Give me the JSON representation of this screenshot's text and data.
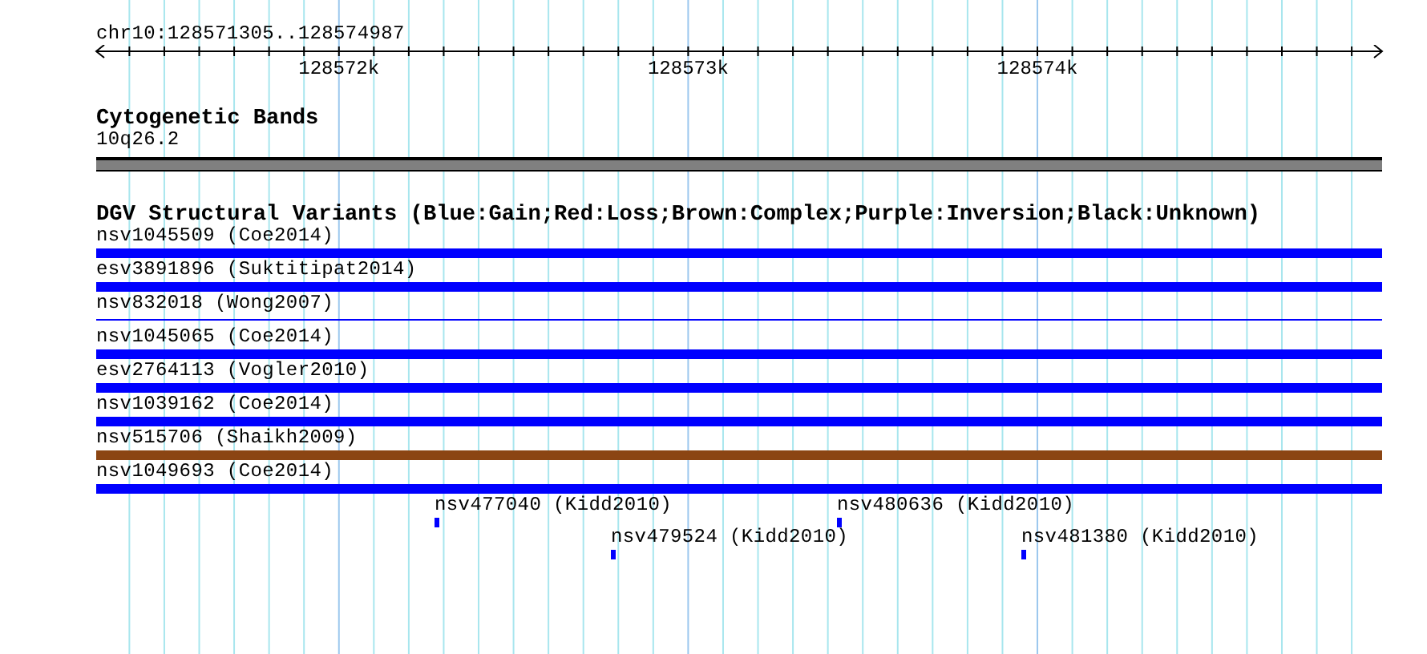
{
  "ruler": {
    "range": "chr10:128571305..128574987",
    "labels": [
      "128572k",
      "128573k",
      "128574k"
    ]
  },
  "cytogenetic_bands": {
    "title": "Cytogenetic Bands",
    "band": "10q26.2"
  },
  "dgv": {
    "title": "DGV Structural Variants (Blue:Gain;Red:Loss;Brown:Complex;Purple:Inversion;Black:Unknown)",
    "variants": [
      {
        "label": "nsv1045509 (Coe2014)",
        "kind": "bar",
        "color": "#0000ff"
      },
      {
        "label": "esv3891896 (Suktitipat2014)",
        "kind": "bar",
        "color": "#0000ff"
      },
      {
        "label": "nsv832018 (Wong2007)",
        "kind": "line",
        "color": "#0000ff"
      },
      {
        "label": "nsv1045065 (Coe2014)",
        "kind": "bar",
        "color": "#0000ff"
      },
      {
        "label": "esv2764113 (Vogler2010)",
        "kind": "bar",
        "color": "#0000ff"
      },
      {
        "label": "nsv1039162 (Coe2014)",
        "kind": "bar",
        "color": "#0000ff"
      },
      {
        "label": "nsv515706 (Shaikh2009)",
        "kind": "bar",
        "color": "#8b4513"
      },
      {
        "label": "nsv1049693 (Coe2014)",
        "kind": "bar",
        "color": "#0000ff"
      }
    ],
    "small_variants": [
      [
        {
          "label": "nsv477040 (Kidd2010)",
          "color": "#0000ff"
        },
        {
          "label": "nsv480636 (Kidd2010)",
          "color": "#0000ff"
        }
      ],
      [
        {
          "label": "nsv479524 (Kidd2010)",
          "color": "#0000ff"
        },
        {
          "label": "nsv481380 (Kidd2010)",
          "color": "#0000ff"
        }
      ]
    ]
  }
}
